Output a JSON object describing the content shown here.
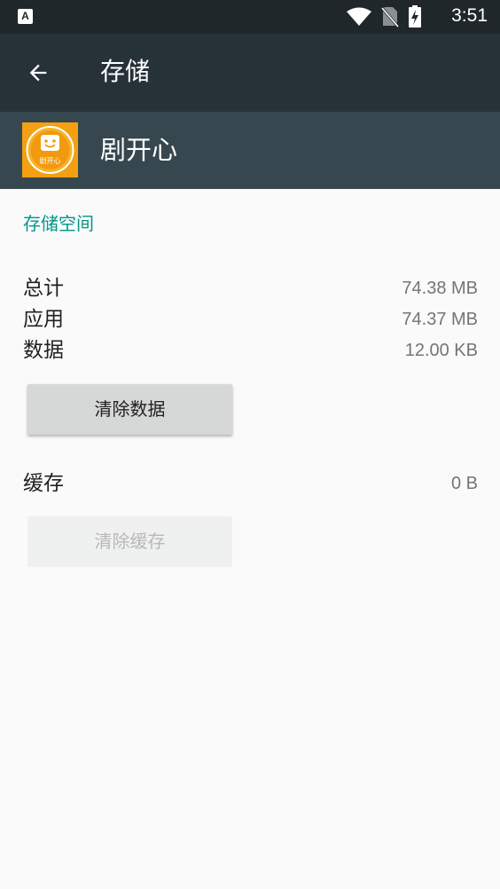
{
  "status_bar": {
    "notification_icon": "A",
    "time": "3:51",
    "icons": [
      "wifi-icon",
      "no-sim-icon",
      "battery-charging-icon"
    ]
  },
  "toolbar": {
    "back_icon": "arrow-back-icon",
    "title": "存储"
  },
  "app": {
    "name": "剧开心",
    "icon_text": "剧开心"
  },
  "storage": {
    "section_title": "存储空间",
    "rows": [
      {
        "label": "总计",
        "value": "74.38 MB"
      },
      {
        "label": "应用",
        "value": "74.37 MB"
      },
      {
        "label": "数据",
        "value": "12.00 KB"
      }
    ],
    "clear_data_label": "清除数据"
  },
  "cache": {
    "label": "缓存",
    "value": "0 B",
    "clear_cache_label": "清除缓存",
    "clear_cache_enabled": false
  },
  "colors": {
    "status_bar": "#1f272b",
    "toolbar": "#263238",
    "app_header": "#37474f",
    "accent": "#009688",
    "background": "#fafafa"
  }
}
